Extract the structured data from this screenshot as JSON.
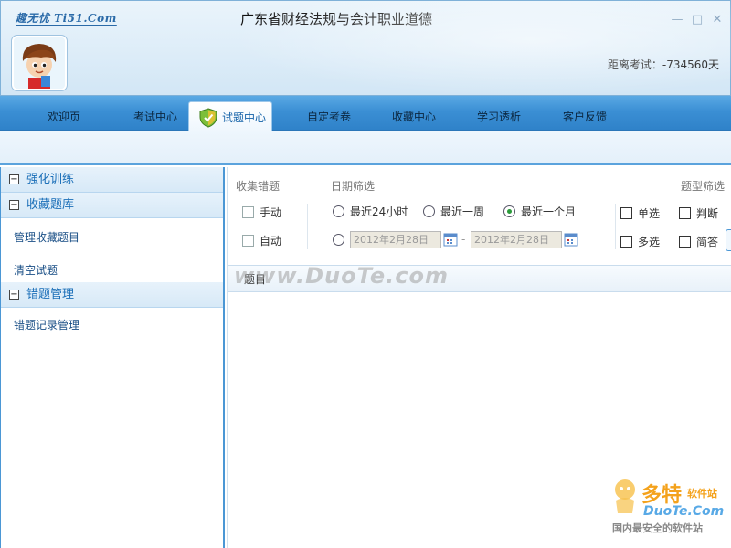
{
  "header": {
    "brand": "趣无忧 Ti51.Com",
    "title": "广东省财经法规与会计职业道德",
    "countdown": "距离考试：-734560天",
    "controls": {
      "minimize": "—",
      "maximize": "□",
      "close": "✕"
    }
  },
  "nav": {
    "tabs": [
      {
        "label": "欢迎页",
        "active": false
      },
      {
        "label": "考试中心",
        "active": false
      },
      {
        "label": "试题中心",
        "active": true,
        "icon": "shield-check-icon"
      },
      {
        "label": "自定考卷",
        "active": false
      },
      {
        "label": "收藏中心",
        "active": false
      },
      {
        "label": "学习透析",
        "active": false
      },
      {
        "label": "客户反馈",
        "active": false
      }
    ]
  },
  "sidebar": {
    "sections": [
      {
        "title": "强化训练",
        "toggle": "−",
        "items": []
      },
      {
        "title": "收藏题库",
        "toggle": "−",
        "items": [
          "管理收藏题目",
          "清空试题"
        ]
      },
      {
        "title": "错题管理",
        "toggle": "−",
        "items": [
          "错题记录管理"
        ]
      }
    ]
  },
  "filters": {
    "collect_label": "收集错题",
    "date_label": "日期筛选",
    "type_label": "题型筛选",
    "collect_options": [
      "手动",
      "自动"
    ],
    "date_options": [
      {
        "label": "最近24小时",
        "selected": false
      },
      {
        "label": "最近一周",
        "selected": false
      },
      {
        "label": "最近一个月",
        "selected": true
      }
    ],
    "custom_range": {
      "selected": false,
      "from": "2012年2月28日",
      "to": "2012年2月28日",
      "separator": "-"
    },
    "type_options": [
      "单选",
      "判断",
      "多选",
      "简答"
    ]
  },
  "list": {
    "column_header": "题目"
  },
  "watermark": {
    "text": "www.DuoTe.com",
    "logo_text": "多特",
    "logo_sub": "软件站",
    "logo_url": "DuoTe.Com",
    "logo_tagline": "国内最安全的软件站"
  },
  "colors": {
    "accent": "#3b8fd4",
    "link": "#1a4f86",
    "section_title": "#1b6fb8",
    "radio_selected": "#2a9a3a"
  }
}
